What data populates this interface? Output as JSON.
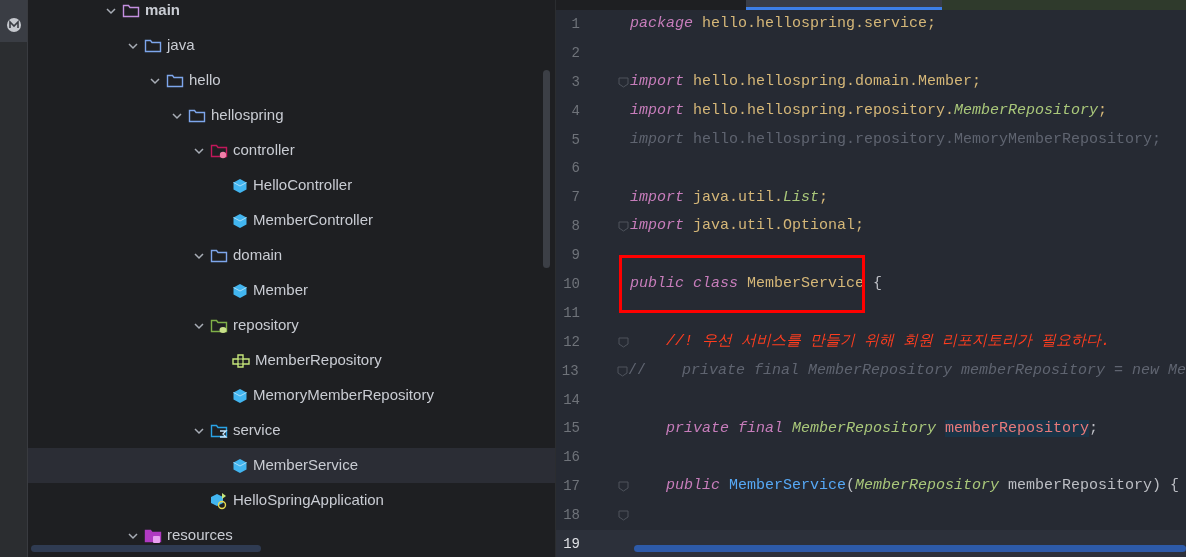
{
  "tree": [
    {
      "label": "main",
      "kind": "folder-main",
      "bold": true,
      "selected": false,
      "expanded": true,
      "children": [
        {
          "label": "java",
          "kind": "folder",
          "bold": false,
          "selected": false,
          "expanded": true,
          "children": [
            {
              "label": "hello",
              "kind": "folder",
              "bold": false,
              "selected": false,
              "expanded": true,
              "children": [
                {
                  "label": "hellospring",
                  "kind": "folder",
                  "bold": false,
                  "selected": false,
                  "expanded": true,
                  "children": [
                    {
                      "label": "controller",
                      "kind": "folder-controller",
                      "bold": false,
                      "selected": false,
                      "expanded": true,
                      "children": [
                        {
                          "label": "HelloController",
                          "kind": "class",
                          "bold": false,
                          "selected": false
                        },
                        {
                          "label": "MemberController",
                          "kind": "class",
                          "bold": false,
                          "selected": false
                        }
                      ]
                    },
                    {
                      "label": "domain",
                      "kind": "folder",
                      "bold": false,
                      "selected": false,
                      "expanded": true,
                      "children": [
                        {
                          "label": "Member",
                          "kind": "class",
                          "bold": false,
                          "selected": false
                        }
                      ]
                    },
                    {
                      "label": "repository",
                      "kind": "folder-repository",
                      "bold": false,
                      "selected": false,
                      "expanded": true,
                      "children": [
                        {
                          "label": "MemberRepository",
                          "kind": "interface",
                          "bold": false,
                          "selected": false
                        },
                        {
                          "label": "MemoryMemberRepository",
                          "kind": "class",
                          "bold": false,
                          "selected": false
                        }
                      ]
                    },
                    {
                      "label": "service",
                      "kind": "folder-service",
                      "bold": false,
                      "selected": false,
                      "expanded": true,
                      "children": [
                        {
                          "label": "MemberService",
                          "kind": "class",
                          "bold": false,
                          "selected": true
                        }
                      ]
                    },
                    {
                      "label": "HelloSpringApplication",
                      "kind": "app",
                      "bold": false,
                      "selected": false
                    }
                  ]
                }
              ]
            }
          ]
        },
        {
          "label": "resources",
          "kind": "folder-resources",
          "bold": false,
          "selected": false,
          "expanded": true
        }
      ]
    }
  ],
  "editor": {
    "lines": [
      {
        "number": "1",
        "fold": false,
        "current": false,
        "boxed": false,
        "tokens": [
          {
            "kind": "keyword",
            "text": "package"
          },
          {
            "kind": "package",
            "text": " hello.hellospring.service;"
          }
        ]
      },
      {
        "number": "2",
        "fold": false,
        "current": false,
        "boxed": false
      },
      {
        "number": "3",
        "fold": true,
        "current": false,
        "boxed": false,
        "tokens": [
          {
            "kind": "keyword",
            "text": "import"
          },
          {
            "kind": "package",
            "text": " hello.hellospring.domain.Member;"
          }
        ]
      },
      {
        "number": "4",
        "fold": false,
        "current": false,
        "boxed": false,
        "tokens": [
          {
            "kind": "keyword",
            "text": "import"
          },
          {
            "kind": "package",
            "text": " hello.hellospring.repository."
          },
          {
            "kind": "type",
            "text": "MemberRepository"
          },
          {
            "kind": "package",
            "text": ";"
          }
        ]
      },
      {
        "number": "5",
        "fold": false,
        "current": false,
        "boxed": false,
        "tokens": [
          {
            "kind": "dim-italic",
            "text": "import"
          },
          {
            "kind": "dim",
            "text": " hello.hellospring.repository.MemoryMemberRepository;"
          }
        ]
      },
      {
        "number": "6",
        "fold": false,
        "current": false,
        "boxed": false
      },
      {
        "number": "7",
        "fold": false,
        "current": false,
        "boxed": false,
        "tokens": [
          {
            "kind": "keyword",
            "text": "import"
          },
          {
            "kind": "package",
            "text": " java.util."
          },
          {
            "kind": "type",
            "text": "List"
          },
          {
            "kind": "package",
            "text": ";"
          }
        ]
      },
      {
        "number": "8",
        "fold": true,
        "current": false,
        "boxed": false,
        "tokens": [
          {
            "kind": "keyword",
            "text": "import"
          },
          {
            "kind": "package",
            "text": " java.util.Optional;"
          }
        ]
      },
      {
        "number": "9",
        "fold": false,
        "current": false,
        "boxed": false
      },
      {
        "number": "10",
        "fold": false,
        "current": false,
        "boxed": true,
        "tokens": [
          {
            "kind": "keyword",
            "text": "public class"
          },
          {
            "kind": "classname",
            "text": " MemberService"
          },
          {
            "kind": "plain",
            "text": " {"
          }
        ]
      },
      {
        "number": "11",
        "fold": false,
        "current": false,
        "boxed": false
      },
      {
        "number": "12",
        "fold": true,
        "current": false,
        "boxed": false,
        "tokens": [
          {
            "kind": "comment",
            "text": "    //! 우선 서비스를 만들기 위해 회원 리포지토리가 필요하다."
          }
        ]
      },
      {
        "number": "13",
        "fold": true,
        "current": false,
        "boxed": false,
        "tokens": [
          {
            "kind": "dim",
            "text": "//    "
          },
          {
            "kind": "dim-italic",
            "text": "private final MemberRepository memberRepository = new Me"
          }
        ]
      },
      {
        "number": "14",
        "fold": false,
        "current": false,
        "boxed": false
      },
      {
        "number": "15",
        "fold": false,
        "current": false,
        "boxed": false,
        "tokens": [
          {
            "kind": "keyword",
            "text": "    private final"
          },
          {
            "kind": "type",
            "text": " MemberRepository "
          },
          {
            "kind": "field-marked",
            "text": "memberRepository"
          },
          {
            "kind": "plain",
            "text": ";"
          }
        ]
      },
      {
        "number": "16",
        "fold": false,
        "current": false,
        "boxed": false
      },
      {
        "number": "17",
        "fold": true,
        "current": false,
        "boxed": false,
        "tokens": [
          {
            "kind": "keyword",
            "text": "    public"
          },
          {
            "kind": "method",
            "text": " MemberService"
          },
          {
            "kind": "plain",
            "text": "("
          },
          {
            "kind": "type",
            "text": "MemberRepository"
          },
          {
            "kind": "plain",
            "text": " memberRepository) {"
          }
        ]
      },
      {
        "number": "18",
        "fold": true,
        "current": false,
        "boxed": false
      },
      {
        "number": "19",
        "fold": false,
        "current": true,
        "boxed": false
      }
    ]
  }
}
